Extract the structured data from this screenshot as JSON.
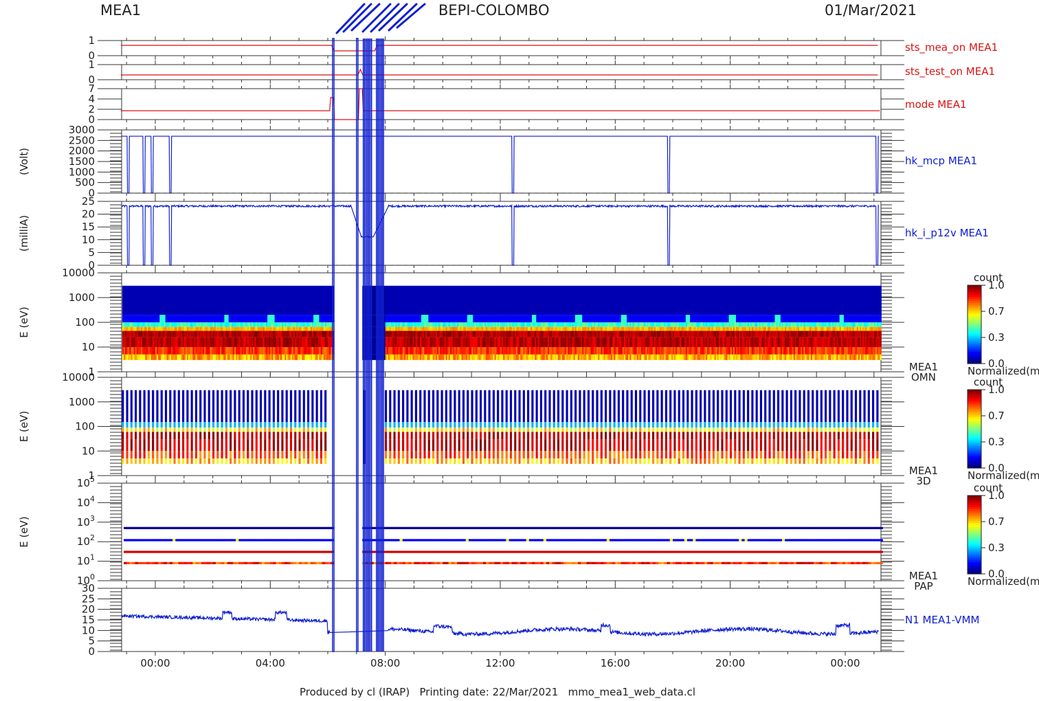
{
  "header": {
    "instrument": "MEA1",
    "mission": "BEPI-COLOMBO",
    "date": "01/Mar/2021"
  },
  "footer": {
    "text": "Produced by cl (IRAP)   Printing date: 22/Mar/2021   mmo_mea1_web_data.cl"
  },
  "colors": {
    "status_red": "#dd1111",
    "data_blue": "#1020d0",
    "axis": "#333333"
  },
  "chart_data": {
    "type": "line",
    "x_axis": {
      "type": "time",
      "range": [
        "2021-02-28T22:48",
        "2021-03-02T01:12"
      ],
      "tick_labels": [
        "00:00",
        "04:00",
        "08:00",
        "12:00",
        "16:00",
        "20:00",
        "00:00"
      ]
    },
    "gap_intervals": [
      [
        "06:05",
        "06:10"
      ],
      [
        "06:50",
        "07:10"
      ],
      [
        "07:30",
        "08:05"
      ]
    ],
    "panels": [
      {
        "label": "sts_mea_on MEA1",
        "label_color": "#dd1111",
        "type": "line",
        "yticks": [
          "1",
          "0"
        ],
        "ylim": [
          0,
          1
        ],
        "values_summary": "constant 1 outside gaps; 0 during 06:10-07:40"
      },
      {
        "label": "sts_test_on MEA1",
        "label_color": "#dd1111",
        "type": "line",
        "yticks": [
          "1",
          "0"
        ],
        "ylim": [
          0,
          1
        ],
        "values_summary": "constant 0 with short spike to 1 near 07:10"
      },
      {
        "label": "mode MEA1",
        "label_color": "#dd1111",
        "type": "line",
        "yticks": [
          "7",
          "4",
          "2",
          "0"
        ],
        "ylim": [
          0,
          7
        ],
        "values_summary": "constant 2; 5 near 06:10; 0 between 06:15 and 07:05; spike to 7 near 07:10"
      },
      {
        "label": "hk_mcp MEA1",
        "label_color": "#1020d0",
        "ylabel": "(Volt)",
        "type": "line",
        "yticks": [
          "3000",
          "2500",
          "2000",
          "1500",
          "1000",
          "500",
          "0"
        ],
        "ylim": [
          0,
          3000
        ],
        "values_summary": "about 2700 V with dropouts to 0 near 23:00, 23:35, 23:55, 00:35, 12:25, 17:50, 01:10"
      },
      {
        "label": "hk_i_p12v MEA1",
        "label_color": "#1020d0",
        "ylabel": "(milliA)",
        "type": "line",
        "yticks": [
          "25",
          "20",
          "15",
          "10",
          "5",
          "0"
        ],
        "ylim": [
          0,
          27
        ],
        "values_summary": "about 25 mA with same dropouts; about 12 mA between 07:10 and 07:35"
      },
      {
        "label": "MEA1",
        "sublabel": "OMN",
        "ylabel": "E (eV)",
        "type": "heatmap",
        "scale": "log",
        "yticks": [
          "10000",
          "1000",
          "100",
          "10",
          "1"
        ],
        "ylim": [
          1,
          10000
        ],
        "colorbar": {
          "title": "count",
          "ticks": [
            "1.0",
            "0.7",
            "0.3",
            "0.0"
          ],
          "label": "Normalized(m"
        }
      },
      {
        "label": "MEA1",
        "sublabel": "3D",
        "ylabel": "E (eV)",
        "type": "heatmap",
        "scale": "log",
        "yticks": [
          "10000",
          "1000",
          "100",
          "10",
          "1"
        ],
        "ylim": [
          1,
          10000
        ],
        "colorbar": {
          "title": "count",
          "ticks": [
            "1.0",
            "0.7",
            "0.3",
            "0.0"
          ],
          "label": "Normalized(m"
        }
      },
      {
        "label": "MEA1",
        "sublabel": "PAP",
        "ylabel": "E (eV)",
        "type": "heatmap",
        "scale": "log",
        "yticks": [
          {
            "base": "10",
            "exp": "5"
          },
          {
            "base": "10",
            "exp": "4"
          },
          {
            "base": "10",
            "exp": "3"
          },
          {
            "base": "10",
            "exp": "2"
          },
          {
            "base": "10",
            "exp": "1"
          },
          {
            "base": "10",
            "exp": "0"
          }
        ],
        "ylim": [
          1,
          100000
        ],
        "bands_eV": [
          500,
          120,
          30,
          8
        ],
        "colorbar": {
          "title": "count",
          "ticks": [
            "1.0",
            "0.7",
            "0.3",
            "0.0"
          ],
          "label": "Normalized(m"
        }
      },
      {
        "label": "N1 MEA1-VMM",
        "label_color": "#1020d0",
        "type": "line",
        "yticks": [
          "30",
          "25",
          "20",
          "15",
          "10",
          "5",
          "0"
        ],
        "ylim": [
          0,
          30
        ],
        "values_summary": "15-18 before 06:00 with peaks to ~20 near 02:30 and 04:20; ~11-12 around 06:00; 7-12 after 08:00 with bumps near 10:00, 15:30, 23:50"
      }
    ]
  }
}
